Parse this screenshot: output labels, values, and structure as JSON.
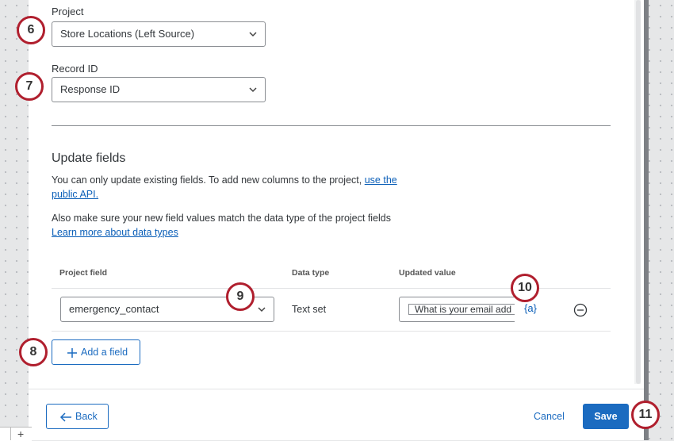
{
  "form": {
    "project": {
      "label": "Project",
      "value": "Store Locations (Left Source)"
    },
    "record_id": {
      "label": "Record ID",
      "value": "Response ID"
    }
  },
  "update_fields": {
    "title": "Update fields",
    "info_text": "You can only update existing fields. To add new columns to the project,",
    "info_link_1": "use the",
    "info_link_2": "public API.",
    "datatype_text": "Also make sure your new field values match the data type of the project fields",
    "datatype_link": "Learn more about data types",
    "columns": [
      "Project field",
      "Data type",
      "Updated value"
    ],
    "rows": [
      {
        "project_field": "emergency_contact",
        "data_type": "Text set",
        "updated_value": "What is your email add"
      }
    ],
    "piped_text_label": "{a}",
    "add_field_label": "Add a field"
  },
  "footer": {
    "back_label": "Back",
    "cancel_label": "Cancel",
    "save_label": "Save"
  },
  "callouts": [
    "6",
    "7",
    "8",
    "9",
    "10",
    "11"
  ],
  "colors": {
    "accent": "#1b6bc0",
    "callout_ring": "#b01f2e",
    "link": "#0b5fb8"
  }
}
